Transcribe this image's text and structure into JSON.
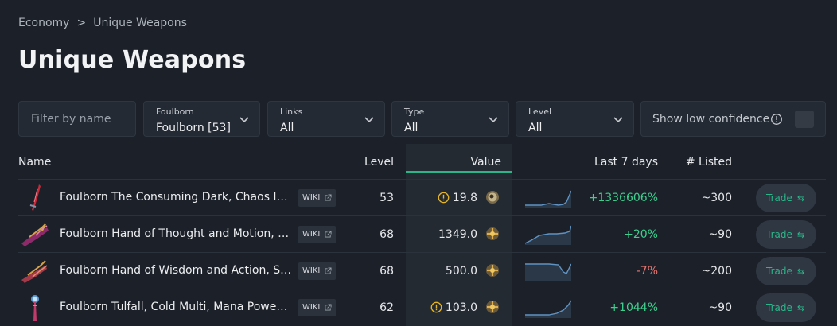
{
  "breadcrumb": {
    "root": "Economy",
    "separator": ">",
    "current": "Unique Weapons"
  },
  "page_title": "Unique Weapons",
  "filters": {
    "name_placeholder": "Filter by name",
    "foulborn": {
      "label": "Foulborn",
      "value": "Foulborn [53]"
    },
    "links": {
      "label": "Links",
      "value": "All"
    },
    "type": {
      "label": "Type",
      "value": "All"
    },
    "level": {
      "label": "Level",
      "value": "All"
    },
    "low_confidence_label": "Show low confidence",
    "low_confidence_checked": false
  },
  "table": {
    "headers": {
      "name": "Name",
      "level": "Level",
      "value": "Value",
      "last7": "Last 7 days",
      "listed": "# Listed"
    },
    "wiki_label": "WIKI",
    "trade_label": "Trade",
    "rows": [
      {
        "name": "Foulborn The Consuming Dark, Chaos Igni...",
        "level": "53",
        "value": "19.8",
        "warning": true,
        "currency": "divine-orb",
        "change": "+1336606%",
        "trend": "up",
        "listed": "~300",
        "weapon_icon": "dagger-icon"
      },
      {
        "name": "Foulborn Hand of Thought and Motion, St...",
        "level": "68",
        "value": "1349.0",
        "warning": false,
        "currency": "chaos-orb",
        "change": "+20%",
        "trend": "up",
        "listed": "~90",
        "weapon_icon": "claw-icon"
      },
      {
        "name": "Foulborn Hand of Wisdom and Action, Str...",
        "level": "68",
        "value": "500.0",
        "warning": false,
        "currency": "chaos-orb",
        "change": "-7%",
        "trend": "down",
        "listed": "~200",
        "weapon_icon": "claw-icon"
      },
      {
        "name": "Foulborn Tulfall, Cold Multi, Mana Power, ...",
        "level": "62",
        "value": "103.0",
        "warning": true,
        "currency": "chaos-orb",
        "change": "+1044%",
        "trend": "up",
        "listed": "~90",
        "weapon_icon": "sceptre-icon"
      }
    ]
  },
  "colors": {
    "background": "#1c2129",
    "accent": "#2bb589",
    "positive": "#3ecf8e",
    "negative": "#e5746f",
    "warning": "#e6b422"
  }
}
